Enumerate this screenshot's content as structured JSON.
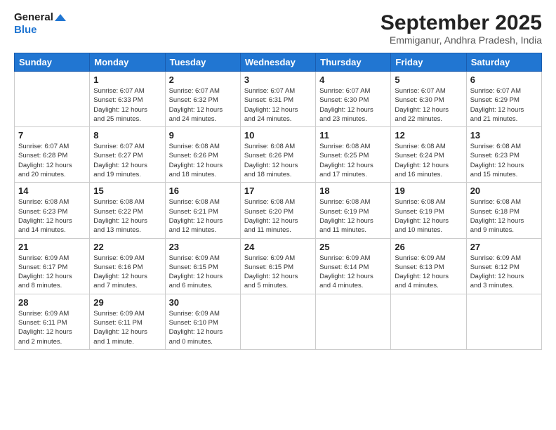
{
  "logo": {
    "line1": "General",
    "line2": "Blue"
  },
  "title": "September 2025",
  "subtitle": "Emmiganur, Andhra Pradesh, India",
  "days_header": [
    "Sunday",
    "Monday",
    "Tuesday",
    "Wednesday",
    "Thursday",
    "Friday",
    "Saturday"
  ],
  "weeks": [
    [
      {
        "day": "",
        "info": ""
      },
      {
        "day": "1",
        "info": "Sunrise: 6:07 AM\nSunset: 6:33 PM\nDaylight: 12 hours\nand 25 minutes."
      },
      {
        "day": "2",
        "info": "Sunrise: 6:07 AM\nSunset: 6:32 PM\nDaylight: 12 hours\nand 24 minutes."
      },
      {
        "day": "3",
        "info": "Sunrise: 6:07 AM\nSunset: 6:31 PM\nDaylight: 12 hours\nand 24 minutes."
      },
      {
        "day": "4",
        "info": "Sunrise: 6:07 AM\nSunset: 6:30 PM\nDaylight: 12 hours\nand 23 minutes."
      },
      {
        "day": "5",
        "info": "Sunrise: 6:07 AM\nSunset: 6:30 PM\nDaylight: 12 hours\nand 22 minutes."
      },
      {
        "day": "6",
        "info": "Sunrise: 6:07 AM\nSunset: 6:29 PM\nDaylight: 12 hours\nand 21 minutes."
      }
    ],
    [
      {
        "day": "7",
        "info": "Sunrise: 6:07 AM\nSunset: 6:28 PM\nDaylight: 12 hours\nand 20 minutes."
      },
      {
        "day": "8",
        "info": "Sunrise: 6:07 AM\nSunset: 6:27 PM\nDaylight: 12 hours\nand 19 minutes."
      },
      {
        "day": "9",
        "info": "Sunrise: 6:08 AM\nSunset: 6:26 PM\nDaylight: 12 hours\nand 18 minutes."
      },
      {
        "day": "10",
        "info": "Sunrise: 6:08 AM\nSunset: 6:26 PM\nDaylight: 12 hours\nand 18 minutes."
      },
      {
        "day": "11",
        "info": "Sunrise: 6:08 AM\nSunset: 6:25 PM\nDaylight: 12 hours\nand 17 minutes."
      },
      {
        "day": "12",
        "info": "Sunrise: 6:08 AM\nSunset: 6:24 PM\nDaylight: 12 hours\nand 16 minutes."
      },
      {
        "day": "13",
        "info": "Sunrise: 6:08 AM\nSunset: 6:23 PM\nDaylight: 12 hours\nand 15 minutes."
      }
    ],
    [
      {
        "day": "14",
        "info": "Sunrise: 6:08 AM\nSunset: 6:23 PM\nDaylight: 12 hours\nand 14 minutes."
      },
      {
        "day": "15",
        "info": "Sunrise: 6:08 AM\nSunset: 6:22 PM\nDaylight: 12 hours\nand 13 minutes."
      },
      {
        "day": "16",
        "info": "Sunrise: 6:08 AM\nSunset: 6:21 PM\nDaylight: 12 hours\nand 12 minutes."
      },
      {
        "day": "17",
        "info": "Sunrise: 6:08 AM\nSunset: 6:20 PM\nDaylight: 12 hours\nand 11 minutes."
      },
      {
        "day": "18",
        "info": "Sunrise: 6:08 AM\nSunset: 6:19 PM\nDaylight: 12 hours\nand 11 minutes."
      },
      {
        "day": "19",
        "info": "Sunrise: 6:08 AM\nSunset: 6:19 PM\nDaylight: 12 hours\nand 10 minutes."
      },
      {
        "day": "20",
        "info": "Sunrise: 6:08 AM\nSunset: 6:18 PM\nDaylight: 12 hours\nand 9 minutes."
      }
    ],
    [
      {
        "day": "21",
        "info": "Sunrise: 6:09 AM\nSunset: 6:17 PM\nDaylight: 12 hours\nand 8 minutes."
      },
      {
        "day": "22",
        "info": "Sunrise: 6:09 AM\nSunset: 6:16 PM\nDaylight: 12 hours\nand 7 minutes."
      },
      {
        "day": "23",
        "info": "Sunrise: 6:09 AM\nSunset: 6:15 PM\nDaylight: 12 hours\nand 6 minutes."
      },
      {
        "day": "24",
        "info": "Sunrise: 6:09 AM\nSunset: 6:15 PM\nDaylight: 12 hours\nand 5 minutes."
      },
      {
        "day": "25",
        "info": "Sunrise: 6:09 AM\nSunset: 6:14 PM\nDaylight: 12 hours\nand 4 minutes."
      },
      {
        "day": "26",
        "info": "Sunrise: 6:09 AM\nSunset: 6:13 PM\nDaylight: 12 hours\nand 4 minutes."
      },
      {
        "day": "27",
        "info": "Sunrise: 6:09 AM\nSunset: 6:12 PM\nDaylight: 12 hours\nand 3 minutes."
      }
    ],
    [
      {
        "day": "28",
        "info": "Sunrise: 6:09 AM\nSunset: 6:11 PM\nDaylight: 12 hours\nand 2 minutes."
      },
      {
        "day": "29",
        "info": "Sunrise: 6:09 AM\nSunset: 6:11 PM\nDaylight: 12 hours\nand 1 minute."
      },
      {
        "day": "30",
        "info": "Sunrise: 6:09 AM\nSunset: 6:10 PM\nDaylight: 12 hours\nand 0 minutes."
      },
      {
        "day": "",
        "info": ""
      },
      {
        "day": "",
        "info": ""
      },
      {
        "day": "",
        "info": ""
      },
      {
        "day": "",
        "info": ""
      }
    ]
  ]
}
